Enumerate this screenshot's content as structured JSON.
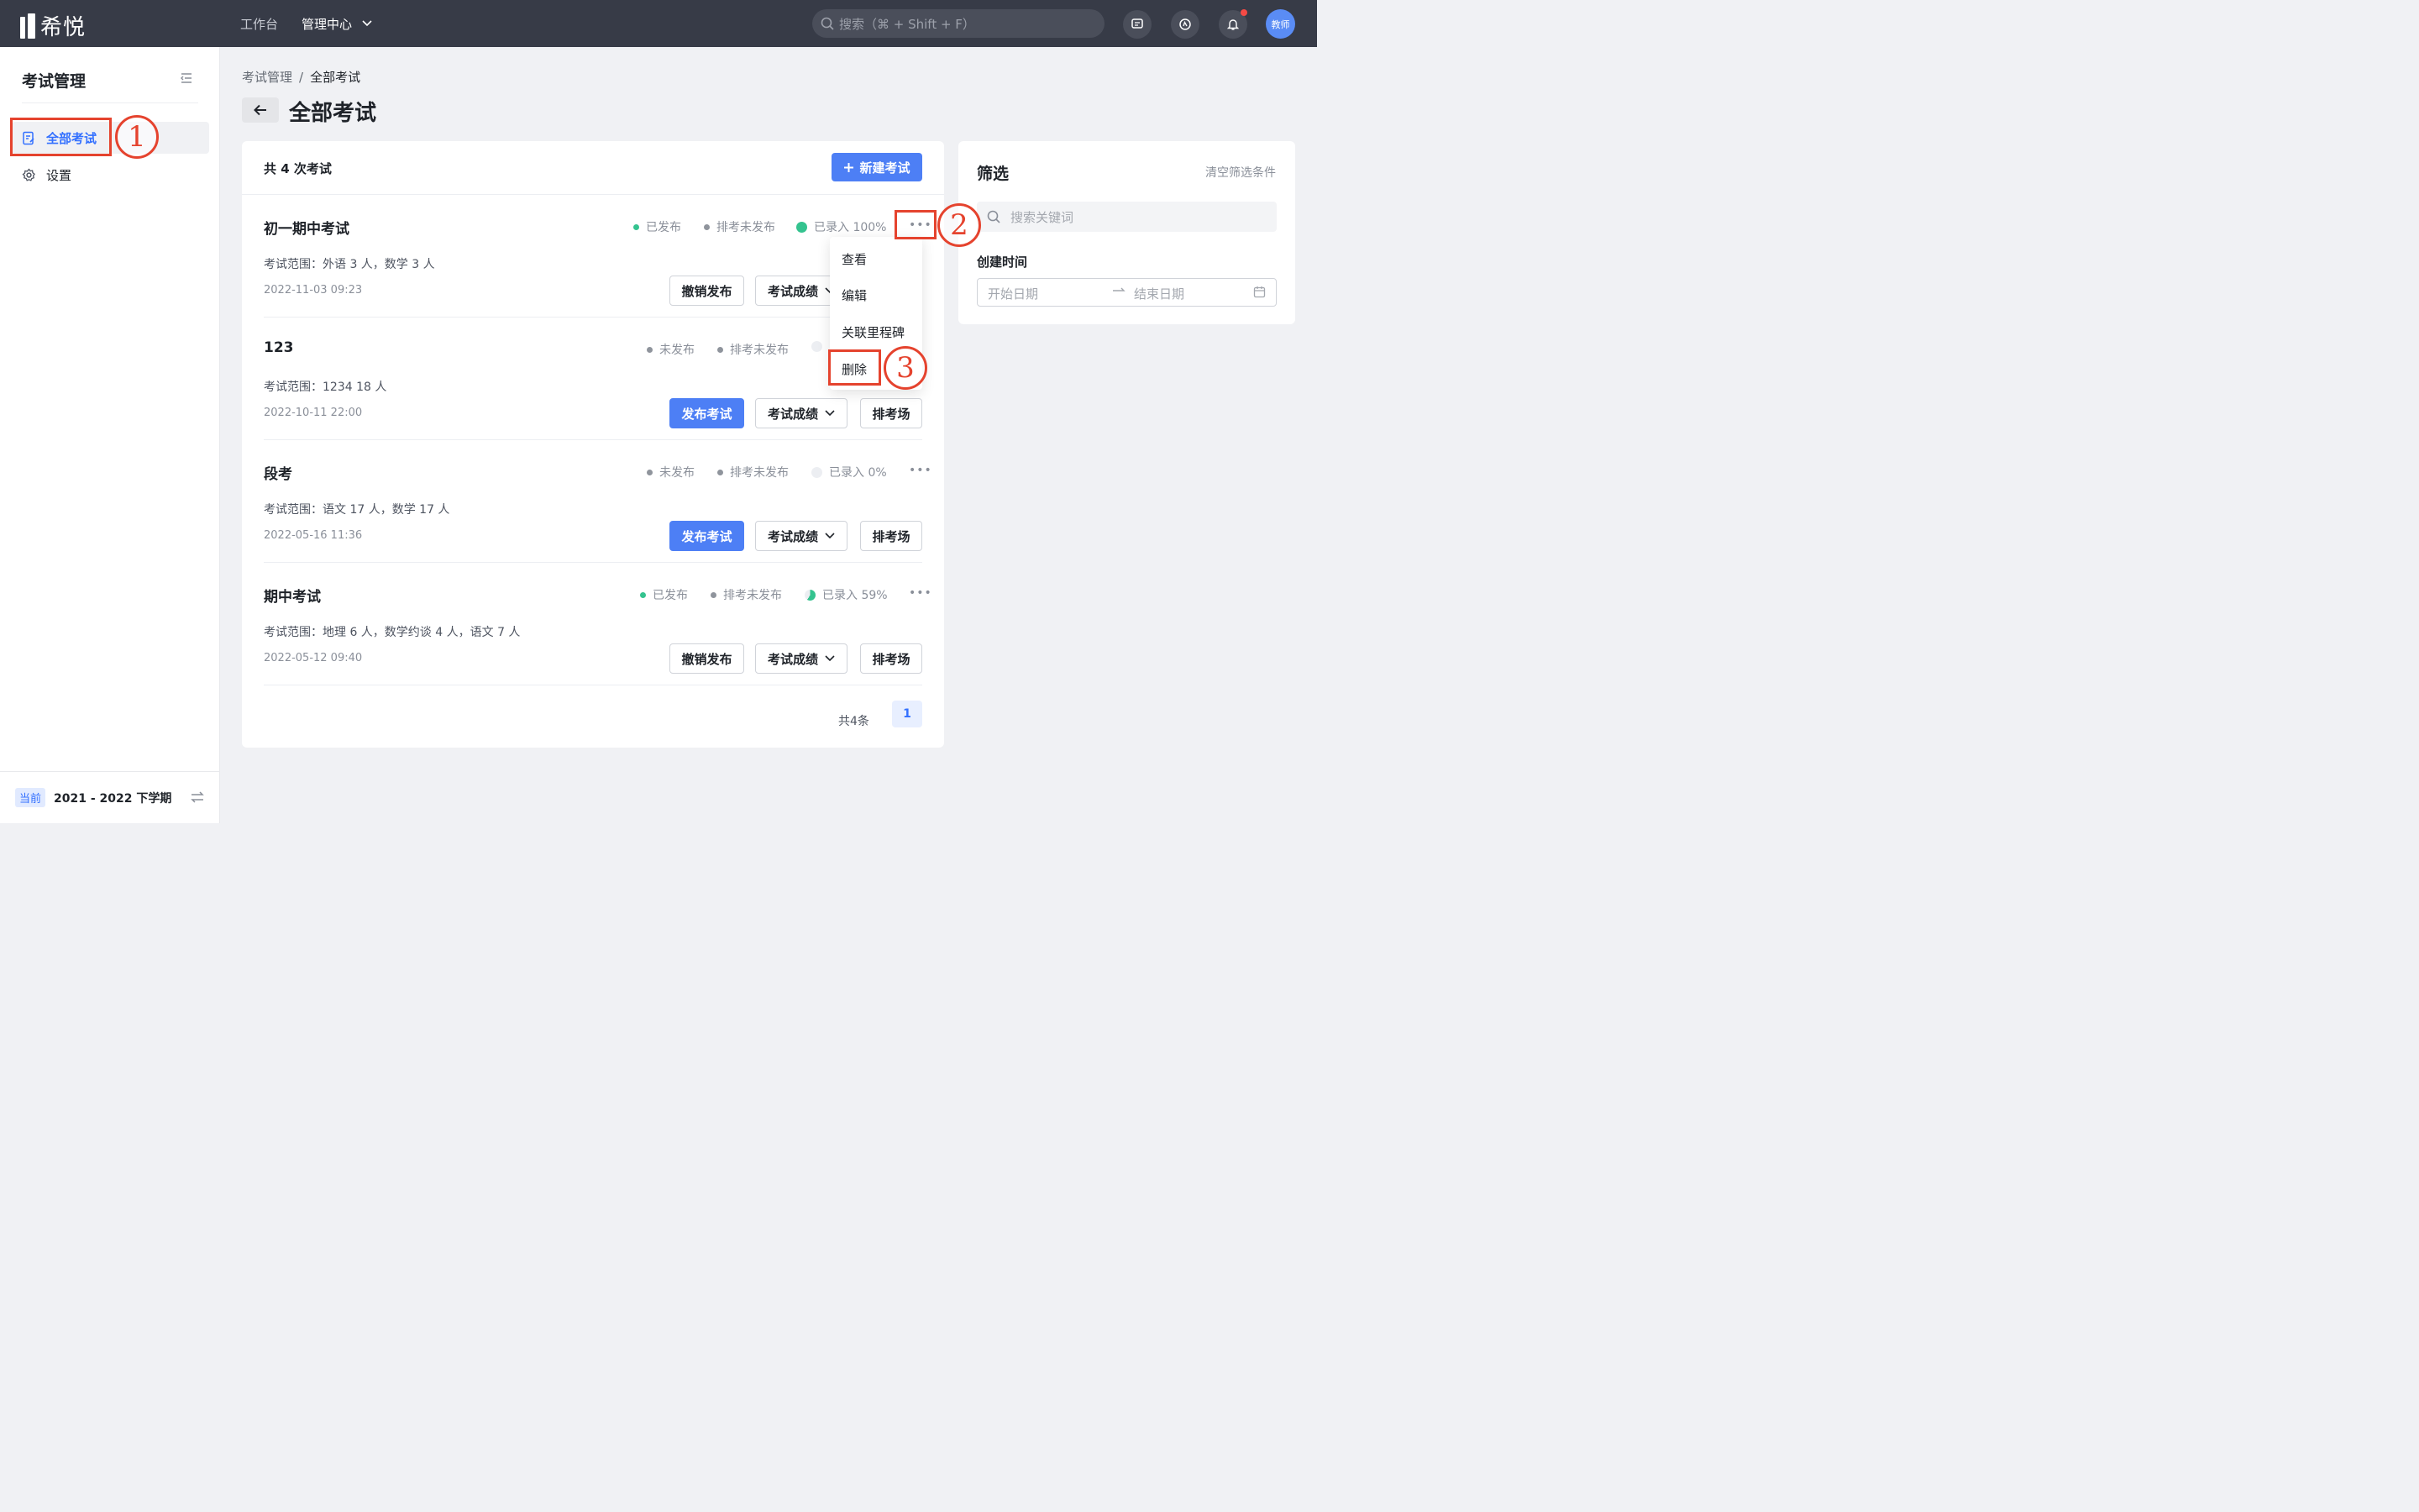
{
  "app": {
    "name": "希悦"
  },
  "nav": {
    "workbench": "工作台",
    "admin_center": "管理中心"
  },
  "search": {
    "placeholder": "搜索（⌘ + Shift + F）"
  },
  "user": {
    "avatar_text": "教师"
  },
  "sidebar": {
    "title": "考试管理",
    "items": [
      {
        "label": "全部考试",
        "icon": "exam-edit-icon",
        "active": true
      },
      {
        "label": "设置",
        "icon": "gear-icon",
        "active": false
      }
    ],
    "term_badge": "当前",
    "term": "2021 - 2022 下学期"
  },
  "breadcrumb": {
    "root": "考试管理",
    "sep": "/",
    "current": "全部考试"
  },
  "page": {
    "title": "全部考试"
  },
  "list": {
    "count_label": "共 4 次考试",
    "new_button": "新建考试",
    "exams": [
      {
        "name": "初一期中考试",
        "publish_status": "已发布",
        "arrange_status": "排考未发布",
        "entered": "已录入 100%",
        "entered_percent": 100,
        "scope": "考试范围：外语 3 人，数学 3 人",
        "date": "2022-11-03 09:23",
        "primary_action": "撤销发布",
        "score_action": "考试成绩",
        "arrange_action": "排考场"
      },
      {
        "name": "123",
        "publish_status": "未发布",
        "arrange_status": "排考未发布",
        "entered": "",
        "entered_percent": 0,
        "scope": "考试范围：1234 18 人",
        "date": "2022-10-11 22:00",
        "primary_action": "发布考试",
        "score_action": "考试成绩",
        "arrange_action": "排考场"
      },
      {
        "name": "段考",
        "publish_status": "未发布",
        "arrange_status": "排考未发布",
        "entered": "已录入 0%",
        "entered_percent": 0,
        "scope": "考试范围：语文 17 人，数学 17 人",
        "date": "2022-05-16 11:36",
        "primary_action": "发布考试",
        "score_action": "考试成绩",
        "arrange_action": "排考场"
      },
      {
        "name": "期中考试",
        "publish_status": "已发布",
        "arrange_status": "排考未发布",
        "entered": "已录入 59%",
        "entered_percent": 59,
        "scope": "考试范围：地理 6 人，数学约谈 4 人，语文 7 人",
        "date": "2022-05-12 09:40",
        "primary_action": "撤销发布",
        "score_action": "考试成绩",
        "arrange_action": "排考场"
      }
    ],
    "total": "共4条",
    "current_page": "1"
  },
  "more_menu": {
    "items": [
      "查看",
      "编辑",
      "关联里程碑",
      "删除"
    ]
  },
  "annotations": [
    "1",
    "2",
    "3"
  ],
  "filter": {
    "title": "筛选",
    "clear": "清空筛选条件",
    "keyword_placeholder": "搜索关键词",
    "created_label": "创建时间",
    "start_placeholder": "开始日期",
    "end_placeholder": "结束日期"
  },
  "colors": {
    "accent": "#4d7ff5",
    "topbar": "#373b47",
    "annotation": "#e5432e",
    "published": "#34c38f"
  }
}
